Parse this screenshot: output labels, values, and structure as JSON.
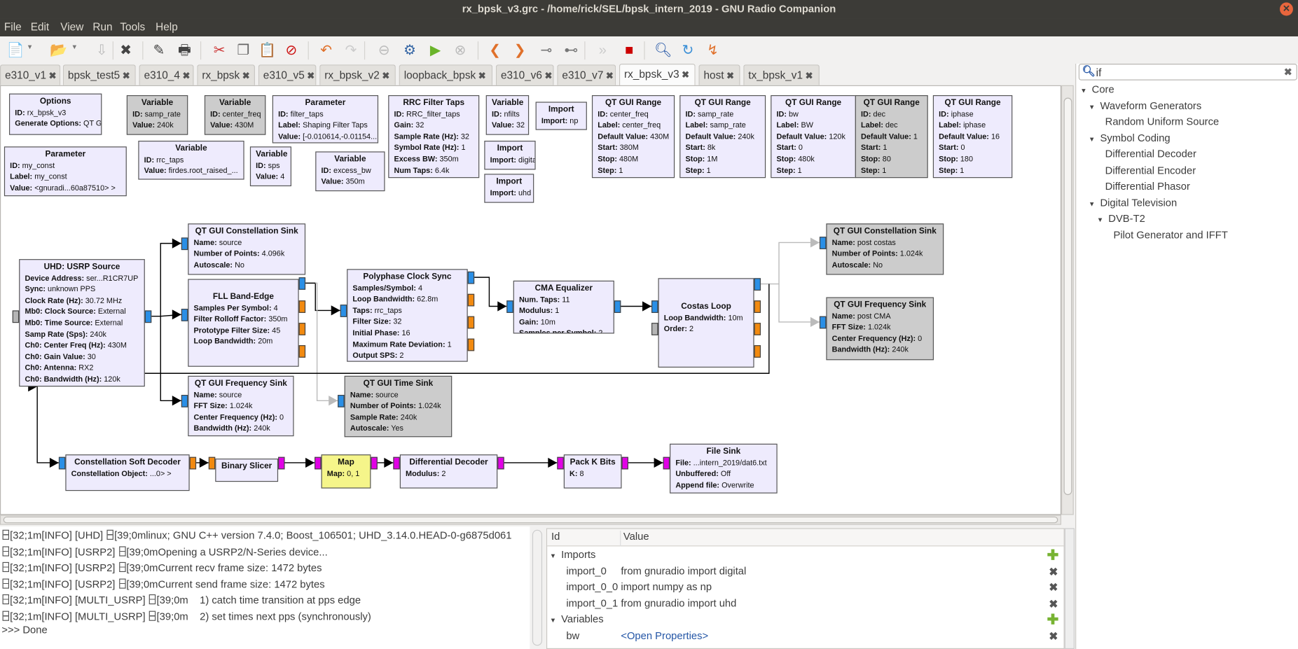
{
  "window": {
    "title": "rx_bpsk_v3.grc - /home/rick/SEL/bpsk_intern_2019 - GNU Radio Companion"
  },
  "menu": [
    "File",
    "Edit",
    "View",
    "Run",
    "Tools",
    "Help"
  ],
  "toolbar": [
    "new-icon",
    "open-icon",
    "save-icon",
    "close-icon",
    "edit-pencil-icon",
    "print-icon",
    "cut-icon",
    "copy-icon",
    "paste-icon",
    "delete-icon",
    "undo-icon",
    "redo-icon",
    "disable-icon",
    "generate-icon",
    "execute-icon",
    "kill-icon",
    "rotate-left-icon",
    "rotate-right-icon",
    "enable-icon",
    "bypass-icon",
    "forward-icon",
    "stop-flowgraph-icon",
    "find-icon",
    "reload-icon",
    "open-hier-icon"
  ],
  "tabs": [
    {
      "label": "e310_v1"
    },
    {
      "label": "bpsk_test5"
    },
    {
      "label": "e310_4"
    },
    {
      "label": "rx_bpsk"
    },
    {
      "label": "e310_v5"
    },
    {
      "label": "rx_bpsk_v2"
    },
    {
      "label": "loopback_bpsk"
    },
    {
      "label": "e310_v6"
    },
    {
      "label": "e310_v7"
    },
    {
      "label": "rx_bpsk_v3",
      "active": true
    },
    {
      "label": "host"
    },
    {
      "label": "tx_bpsk_v1"
    }
  ],
  "tab_close": "✖",
  "blocks": [
    {
      "title": "Options",
      "params": [
        [
          "ID:",
          "rx_bpsk_v3"
        ],
        [
          "Generate Options:",
          "QT GUI"
        ]
      ]
    },
    {
      "title": "Variable",
      "state": "disabled",
      "params": [
        [
          "ID:",
          "samp_rate"
        ],
        [
          "Value:",
          "240k"
        ]
      ]
    },
    {
      "title": "Variable",
      "state": "disabled",
      "params": [
        [
          "ID:",
          "center_freq"
        ],
        [
          "Value:",
          "430M"
        ]
      ]
    },
    {
      "title": "Parameter",
      "params": [
        [
          "ID:",
          "filter_taps"
        ],
        [
          "Label:",
          "Shaping Filter Taps"
        ],
        [
          "Value:",
          "[-0.010614,-0.01154..."
        ]
      ]
    },
    {
      "title": "RRC Filter Taps",
      "params": [
        [
          "ID:",
          "RRC_filter_taps"
        ],
        [
          "Gain:",
          "32"
        ],
        [
          "Sample Rate (Hz):",
          "32"
        ],
        [
          "Symbol Rate (Hz):",
          "1"
        ],
        [
          "Excess BW:",
          "350m"
        ],
        [
          "Num Taps:",
          "6.4k"
        ]
      ]
    },
    {
      "title": "Variable",
      "params": [
        [
          "ID:",
          "nfilts"
        ],
        [
          "Value:",
          "32"
        ]
      ]
    },
    {
      "title": "Import",
      "params": [
        [
          "Import:",
          "np"
        ]
      ]
    },
    {
      "title": "Import",
      "params": [
        [
          "Import:",
          "digital"
        ]
      ]
    },
    {
      "title": "Import",
      "params": [
        [
          "Import:",
          "uhd"
        ]
      ]
    },
    {
      "title": "QT GUI Range",
      "params": [
        [
          "ID:",
          "center_freq"
        ],
        [
          "Label:",
          "center_freq"
        ],
        [
          "Default Value:",
          "430M"
        ],
        [
          "Start:",
          "380M"
        ],
        [
          "Stop:",
          "480M"
        ],
        [
          "Step:",
          "1"
        ]
      ]
    },
    {
      "title": "QT GUI Range",
      "params": [
        [
          "ID:",
          "samp_rate"
        ],
        [
          "Label:",
          "samp_rate"
        ],
        [
          "Default Value:",
          "240k"
        ],
        [
          "Start:",
          "8k"
        ],
        [
          "Stop:",
          "1M"
        ],
        [
          "Step:",
          "1"
        ]
      ]
    },
    {
      "title": "QT GUI Range",
      "params": [
        [
          "ID:",
          "bw"
        ],
        [
          "Label:",
          "BW"
        ],
        [
          "Default Value:",
          "120k"
        ],
        [
          "Start:",
          "0"
        ],
        [
          "Stop:",
          "480k"
        ],
        [
          "Step:",
          "1"
        ]
      ]
    },
    {
      "title": "QT GUI Range",
      "state": "disabled",
      "params": [
        [
          "ID:",
          "dec"
        ],
        [
          "Label:",
          "dec"
        ],
        [
          "Default Value:",
          "1"
        ],
        [
          "Start:",
          "1"
        ],
        [
          "Stop:",
          "80"
        ],
        [
          "Step:",
          "1"
        ]
      ]
    },
    {
      "title": "QT GUI Range",
      "params": [
        [
          "ID:",
          "iphase"
        ],
        [
          "Label:",
          "iphase"
        ],
        [
          "Default Value:",
          "16"
        ],
        [
          "Start:",
          "0"
        ],
        [
          "Stop:",
          "180"
        ],
        [
          "Step:",
          "1"
        ]
      ]
    },
    {
      "title": "Parameter",
      "params": [
        [
          "ID:",
          "my_const"
        ],
        [
          "Label:",
          "my_const"
        ],
        [
          "Value:",
          "<gnuradi...60a87510> >"
        ]
      ]
    },
    {
      "title": "Variable",
      "params": [
        [
          "ID:",
          "rrc_taps"
        ],
        [
          "Value:",
          "firdes.root_raised_..."
        ]
      ]
    },
    {
      "title": "Variable",
      "params": [
        [
          "ID:",
          "sps"
        ],
        [
          "Value:",
          "4"
        ]
      ]
    },
    {
      "title": "Variable",
      "params": [
        [
          "ID:",
          "excess_bw"
        ],
        [
          "Value:",
          "350m"
        ]
      ]
    },
    {
      "title": "UHD: USRP Source",
      "params": [
        [
          "Device Address:",
          "ser...R1CR7UP"
        ],
        [
          "Sync:",
          "unknown PPS"
        ],
        [
          "Clock Rate (Hz):",
          "30.72 MHz"
        ],
        [
          "Mb0: Clock Source:",
          "External"
        ],
        [
          "Mb0: Time Source:",
          "External"
        ],
        [
          "Samp Rate (Sps):",
          "240k"
        ],
        [
          "Ch0: Center Freq (Hz):",
          "430M"
        ],
        [
          "Ch0: Gain Value:",
          "30"
        ],
        [
          "Ch0: Antenna:",
          "RX2"
        ],
        [
          "Ch0: Bandwidth (Hz):",
          "120k"
        ]
      ]
    },
    {
      "title": "QT GUI Constellation Sink",
      "params": [
        [
          "Name:",
          "source"
        ],
        [
          "Number of Points:",
          "4.096k"
        ],
        [
          "Autoscale:",
          "No"
        ]
      ]
    },
    {
      "title": "FLL Band-Edge",
      "params": [
        [
          "Samples Per Symbol:",
          "4"
        ],
        [
          "Filter Rolloff Factor:",
          "350m"
        ],
        [
          "Prototype Filter Size:",
          "45"
        ],
        [
          "Loop Bandwidth:",
          "20m"
        ]
      ]
    },
    {
      "title": "Polyphase Clock Sync",
      "params": [
        [
          "Samples/Symbol:",
          "4"
        ],
        [
          "Loop Bandwidth:",
          "62.8m"
        ],
        [
          "Taps:",
          "rrc_taps"
        ],
        [
          "Filter Size:",
          "32"
        ],
        [
          "Initial Phase:",
          "16"
        ],
        [
          "Maximum Rate Deviation:",
          "1"
        ],
        [
          "Output SPS:",
          "2"
        ]
      ]
    },
    {
      "title": "CMA Equalizer",
      "params": [
        [
          "Num. Taps:",
          "11"
        ],
        [
          "Modulus:",
          "1"
        ],
        [
          "Gain:",
          "10m"
        ],
        [
          "Samples per Symbol:",
          "2"
        ]
      ]
    },
    {
      "title": "Costas Loop",
      "params": [
        [
          "Loop Bandwidth:",
          "10m"
        ],
        [
          "Order:",
          "2"
        ]
      ]
    },
    {
      "title": "QT GUI Constellation Sink",
      "state": "disabled",
      "params": [
        [
          "Name:",
          "post costas"
        ],
        [
          "Number of Points:",
          "1.024k"
        ],
        [
          "Autoscale:",
          "No"
        ]
      ]
    },
    {
      "title": "QT GUI Frequency Sink",
      "state": "disabled",
      "params": [
        [
          "Name:",
          "post CMA"
        ],
        [
          "FFT Size:",
          "1.024k"
        ],
        [
          "Center Frequency (Hz):",
          "0"
        ],
        [
          "Bandwidth (Hz):",
          "240k"
        ]
      ]
    },
    {
      "title": "QT GUI Frequency Sink",
      "params": [
        [
          "Name:",
          "source"
        ],
        [
          "FFT Size:",
          "1.024k"
        ],
        [
          "Center Frequency (Hz):",
          "0"
        ],
        [
          "Bandwidth (Hz):",
          "240k"
        ]
      ]
    },
    {
      "title": "QT GUI Time Sink",
      "state": "disabled",
      "params": [
        [
          "Name:",
          "source"
        ],
        [
          "Number of Points:",
          "1.024k"
        ],
        [
          "Sample Rate:",
          "240k"
        ],
        [
          "Autoscale:",
          "Yes"
        ]
      ]
    },
    {
      "title": "Constellation Soft Decoder",
      "params": [
        [
          "Constellation Object:",
          "...0> >"
        ]
      ]
    },
    {
      "title": "Binary Slicer",
      "params": []
    },
    {
      "title": "Map",
      "params": [
        [
          "Map:",
          "0, 1"
        ]
      ]
    },
    {
      "title": "Differential Decoder",
      "params": [
        [
          "Modulus:",
          "2"
        ]
      ]
    },
    {
      "title": "Pack K Bits",
      "params": [
        [
          "K:",
          "8"
        ]
      ]
    },
    {
      "title": "File Sink",
      "params": [
        [
          "File:",
          "...intern_2019/dat6.txt"
        ],
        [
          "Unbuffered:",
          "Off"
        ],
        [
          "Append file:",
          "Overwrite"
        ]
      ]
    }
  ],
  "colors": {
    "block": "#eeebfd",
    "disabled_block": "#cccccc",
    "map_block": "#f5f58a",
    "complex_port": "#2a8fe6",
    "float_port": "#f28a10",
    "byte_port": "#e100e6",
    "message_port": "#b5b5b5"
  },
  "console": {
    "lines": [
      [
        "[32;1m[INFO] [UHD] ",
        "[39;0mlinux; GNU C++ version 7.4.0; Boost_106501; UHD_3.14.0.HEAD-0-g6875d061"
      ],
      [
        "[32;1m[INFO] [USRP2] ",
        "[39;0mOpening a USRP2/N-Series device..."
      ],
      [
        "[32;1m[INFO] [USRP2] ",
        "[39;0mCurrent recv frame size: 1472 bytes"
      ],
      [
        "[32;1m[INFO] [USRP2] ",
        "[39;0mCurrent send frame size: 1472 bytes"
      ],
      [
        "[32;1m[INFO] [MULTI_USRP] ",
        "[39;0m    1) catch time transition at pps edge"
      ],
      [
        "[32;1m[INFO] [MULTI_USRP] ",
        "[39;0m    2) set times next pps (synchronously)"
      ]
    ],
    "done": ">>> Done"
  },
  "variables_panel": {
    "col_id": "Id",
    "col_value": "Value",
    "rows": [
      {
        "id": "Imports",
        "group": true
      },
      {
        "id": "import_0",
        "value": "from gnuradio import digital"
      },
      {
        "id": "import_0_0",
        "value": "import numpy as np"
      },
      {
        "id": "import_0_1",
        "value": "from gnuradio import uhd"
      },
      {
        "id": "Variables",
        "group": true
      },
      {
        "id": "bw",
        "value": "<Open Properties>",
        "link": true
      }
    ]
  },
  "block_tree": {
    "search_value": "if",
    "items": [
      {
        "label": "Core",
        "level": 0,
        "expanded": true
      },
      {
        "label": "Waveform Generators",
        "level": 1,
        "expanded": true
      },
      {
        "label": "Random Uniform Source",
        "level": 2
      },
      {
        "label": "Symbol Coding",
        "level": 1,
        "expanded": true
      },
      {
        "label": "Differential Decoder",
        "level": 2
      },
      {
        "label": "Differential Encoder",
        "level": 2
      },
      {
        "label": "Differential Phasor",
        "level": 2
      },
      {
        "label": "Digital Television",
        "level": 1,
        "expanded": true
      },
      {
        "label": "DVB-T2",
        "level": 2,
        "expanded": true
      },
      {
        "label": "Pilot Generator and IFFT",
        "level": 3
      }
    ]
  }
}
